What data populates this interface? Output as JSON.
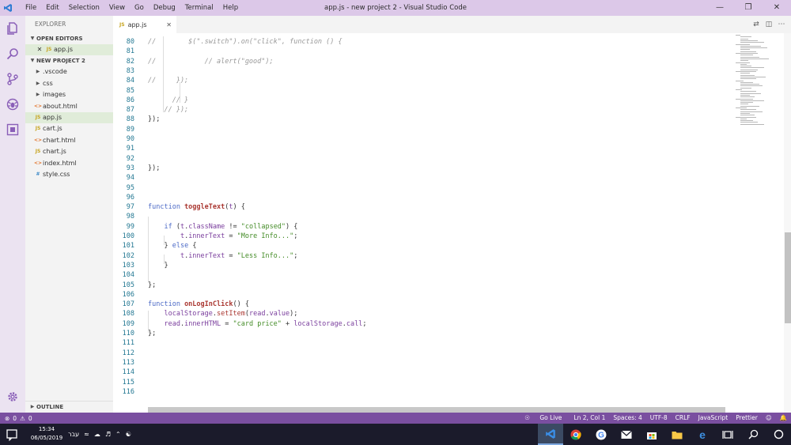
{
  "window": {
    "title": "app.js - new project 2 - Visual Studio Code",
    "menu": [
      "File",
      "Edit",
      "Selection",
      "View",
      "Go",
      "Debug",
      "Terminal",
      "Help"
    ]
  },
  "activity_bar": {
    "icons": [
      "files-icon",
      "search-icon",
      "source-control-icon",
      "debug-icon",
      "extensions-icon"
    ],
    "bottom_icon": "gear-icon"
  },
  "sidebar": {
    "title": "EXPLORER",
    "open_editors_label": "OPEN EDITORS",
    "open_editors": [
      {
        "name": "app.js",
        "kind": "js"
      }
    ],
    "project_label": "NEW PROJECT 2",
    "files": [
      {
        "name": ".vscode",
        "kind": "folder"
      },
      {
        "name": "css",
        "kind": "folder"
      },
      {
        "name": "images",
        "kind": "folder"
      },
      {
        "name": "about.html",
        "kind": "html"
      },
      {
        "name": "app.js",
        "kind": "js",
        "selected": true
      },
      {
        "name": "cart.js",
        "kind": "js"
      },
      {
        "name": "chart.html",
        "kind": "html"
      },
      {
        "name": "chart.js",
        "kind": "js"
      },
      {
        "name": "index.html",
        "kind": "html"
      },
      {
        "name": "style.css",
        "kind": "css"
      }
    ],
    "outline_label": "OUTLINE",
    "badges": {
      "js": "JS",
      "html": "<>",
      "css": "#"
    }
  },
  "tab": {
    "label": "app.js",
    "badge": "JS"
  },
  "editor": {
    "lines": [
      {
        "n": "80",
        "t": [
          [
            "cm",
            "//        $(\".switch\").on(\"click\", function () {"
          ]
        ]
      },
      {
        "n": "81",
        "t": []
      },
      {
        "n": "82",
        "t": [
          [
            "cm",
            "//            // alert(\"good\");"
          ]
        ]
      },
      {
        "n": "83",
        "t": []
      },
      {
        "n": "84",
        "t": [
          [
            "cm",
            "//     });"
          ]
        ]
      },
      {
        "n": "85",
        "t": []
      },
      {
        "n": "86",
        "t": [
          [
            "cm",
            "      // }"
          ]
        ]
      },
      {
        "n": "87",
        "t": [
          [
            "cm",
            "    // });"
          ]
        ]
      },
      {
        "n": "88",
        "t": [
          [
            "p",
            "});"
          ]
        ]
      },
      {
        "n": "89",
        "t": []
      },
      {
        "n": "90",
        "t": []
      },
      {
        "n": "91",
        "t": []
      },
      {
        "n": "92",
        "t": []
      },
      {
        "n": "93",
        "t": [
          [
            "p",
            "});"
          ]
        ]
      },
      {
        "n": "94",
        "t": []
      },
      {
        "n": "95",
        "t": []
      },
      {
        "n": "96",
        "t": []
      },
      {
        "n": "97",
        "t": [
          [
            "kw",
            "function "
          ],
          [
            "fn",
            "toggleText"
          ],
          [
            "p",
            "("
          ],
          [
            "id",
            "t"
          ],
          [
            "p",
            ") {"
          ]
        ]
      },
      {
        "n": "98",
        "t": []
      },
      {
        "n": "99",
        "t": [
          [
            "kw",
            "    if "
          ],
          [
            "p",
            "("
          ],
          [
            "id",
            "t"
          ],
          [
            "p",
            "."
          ],
          [
            "id",
            "className"
          ],
          [
            "p",
            " != "
          ],
          [
            "str",
            "\"collapsed\""
          ],
          [
            "p",
            ") {"
          ]
        ]
      },
      {
        "n": "100",
        "t": [
          [
            "id",
            "        t"
          ],
          [
            "p",
            "."
          ],
          [
            "id",
            "innerText"
          ],
          [
            "p",
            " = "
          ],
          [
            "str",
            "\"More Info...\""
          ],
          [
            "p",
            ";"
          ]
        ]
      },
      {
        "n": "101",
        "t": [
          [
            "p",
            "    } "
          ],
          [
            "kw",
            "else"
          ],
          [
            "p",
            " {"
          ]
        ]
      },
      {
        "n": "102",
        "t": [
          [
            "id",
            "        t"
          ],
          [
            "p",
            "."
          ],
          [
            "id",
            "innerText"
          ],
          [
            "p",
            " = "
          ],
          [
            "str",
            "\"Less Info...\""
          ],
          [
            "p",
            ";"
          ]
        ]
      },
      {
        "n": "103",
        "t": [
          [
            "p",
            "    }"
          ]
        ]
      },
      {
        "n": "104",
        "t": []
      },
      {
        "n": "105",
        "t": [
          [
            "p",
            "};"
          ]
        ]
      },
      {
        "n": "106",
        "t": []
      },
      {
        "n": "107",
        "t": [
          [
            "kw",
            "function "
          ],
          [
            "fn",
            "onLogInClick"
          ],
          [
            "p",
            "() {"
          ]
        ]
      },
      {
        "n": "108",
        "t": [
          [
            "id",
            "    localStorage"
          ],
          [
            "p",
            "."
          ],
          [
            "mt",
            "setItem"
          ],
          [
            "p",
            "("
          ],
          [
            "id",
            "read"
          ],
          [
            "p",
            "."
          ],
          [
            "id",
            "value"
          ],
          [
            "p",
            ");"
          ]
        ]
      },
      {
        "n": "109",
        "t": [
          [
            "id",
            "    read"
          ],
          [
            "p",
            "."
          ],
          [
            "id",
            "innerHTML"
          ],
          [
            "p",
            " = "
          ],
          [
            "str",
            "\"card price\""
          ],
          [
            "p",
            " + "
          ],
          [
            "id",
            "localStorage"
          ],
          [
            "p",
            "."
          ],
          [
            "id",
            "call"
          ],
          [
            "p",
            ";"
          ]
        ]
      },
      {
        "n": "110",
        "t": [
          [
            "p",
            "};"
          ]
        ]
      },
      {
        "n": "111",
        "t": []
      },
      {
        "n": "112",
        "t": []
      },
      {
        "n": "113",
        "t": []
      },
      {
        "n": "114",
        "t": []
      },
      {
        "n": "115",
        "t": []
      },
      {
        "n": "116",
        "t": []
      }
    ]
  },
  "statusbar": {
    "errors": "0",
    "warnings": "0",
    "go_live": "Go Live",
    "position": "Ln 2, Col 1",
    "spaces": "Spaces: 4",
    "encoding": "UTF-8",
    "eol": "CRLF",
    "language": "JavaScript",
    "formatter": "Prettier"
  },
  "taskbar": {
    "time": "15:34",
    "date": "06/05/2019",
    "language": "עבר",
    "apps": [
      "vscode-icon",
      "chrome-icon",
      "google-icon",
      "mail-icon",
      "store-icon",
      "file-explorer-icon",
      "edge-icon",
      "task-view-icon",
      "search-icon",
      "cortana-icon"
    ]
  },
  "colors": {
    "accent": "#7a4fa0",
    "titlebar": "#dcc8e8",
    "activitybar": "#ebe3f1",
    "icon": "#8a5fb8"
  }
}
